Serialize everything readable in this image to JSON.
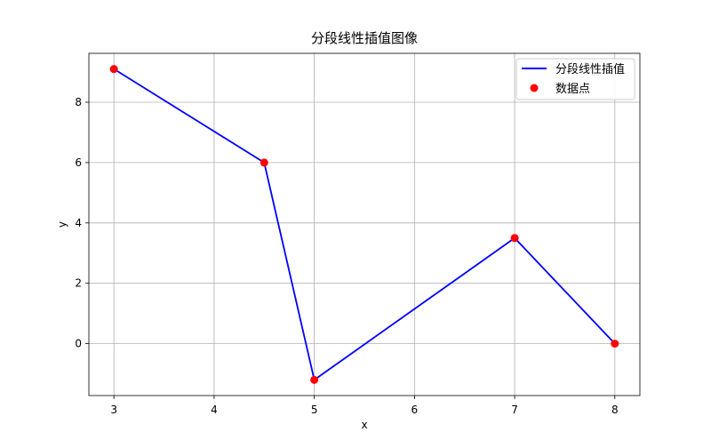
{
  "chart_data": {
    "type": "line",
    "title": "分段线性插值图像",
    "xlabel": "x",
    "ylabel": "y",
    "xlim": [
      2.75,
      8.25
    ],
    "ylim": [
      -1.72,
      9.62
    ],
    "xticks": [
      3,
      4,
      5,
      6,
      7,
      8
    ],
    "yticks": [
      0,
      2,
      4,
      6,
      8
    ],
    "grid": true,
    "legend_position": "top-right",
    "series": [
      {
        "name": "分段线性插值",
        "kind": "line",
        "color": "#0000ff",
        "x": [
          3,
          4.5,
          5,
          7,
          8
        ],
        "y": [
          9.1,
          6.0,
          -1.2,
          3.5,
          0.0
        ]
      },
      {
        "name": "数据点",
        "kind": "scatter",
        "color": "#ff0000",
        "x": [
          3,
          4.5,
          5,
          7,
          8
        ],
        "y": [
          9.1,
          6.0,
          -1.2,
          3.5,
          0.0
        ]
      }
    ]
  }
}
